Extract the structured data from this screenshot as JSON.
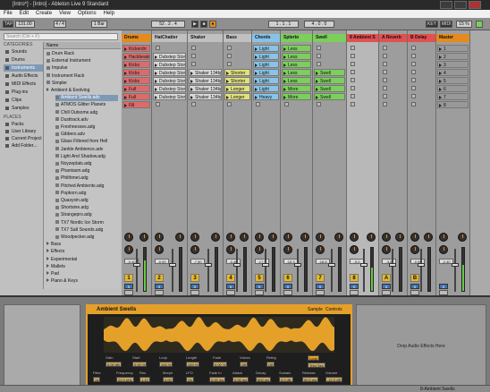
{
  "window": {
    "title": "[Intro*] - [Intro] - Ableton Live 9 Standard"
  },
  "menu": [
    "File",
    "Edit",
    "Create",
    "View",
    "Options",
    "Help"
  ],
  "transport": {
    "tap": "TAP",
    "tempo": "131.00",
    "signature": "4 / 4",
    "quantize": "1 Bar",
    "position": "52 . 2 . 4",
    "loop_start": "1 . 1 . 1",
    "loop_length": "4 . 0 . 0",
    "key": "KEY",
    "midi": "MIDI",
    "cpu": "15 %"
  },
  "browser": {
    "search_placeholder": "Search (Ctrl + F)",
    "categories_header": "CATEGORIES",
    "categories": [
      "Sounds",
      "Drums",
      "Instruments",
      "Audio Effects",
      "MIDI Effects",
      "Plug-ins",
      "Clips",
      "Samples"
    ],
    "places_header": "PLACES",
    "places": [
      "Packs",
      "User Library",
      "Current Project",
      "Add Folder..."
    ],
    "name_header": "Name",
    "files": [
      {
        "name": "Drum Rack",
        "indent": 0,
        "folder": false
      },
      {
        "name": "External Instrument",
        "indent": 0,
        "folder": false
      },
      {
        "name": "Impulse",
        "indent": 0,
        "folder": false
      },
      {
        "name": "Instrument Rack",
        "indent": 0,
        "folder": false
      },
      {
        "name": "Simpler",
        "indent": 0,
        "folder": false
      },
      {
        "name": "Ambient & Evolving",
        "indent": 0,
        "folder": true
      },
      {
        "name": "Ambient Swells.adv",
        "indent": 1,
        "folder": false,
        "selected": true
      },
      {
        "name": "ATMOS Glitter Planets",
        "indent": 1,
        "folder": false
      },
      {
        "name": "Chill Outsome.adg",
        "indent": 1,
        "folder": false
      },
      {
        "name": "Dusttrack.adv",
        "indent": 1,
        "folder": false
      },
      {
        "name": "Freshnesses.adg",
        "indent": 1,
        "folder": false
      },
      {
        "name": "Gibbers.adv",
        "indent": 1,
        "folder": false
      },
      {
        "name": "Glass Filtered from Hell",
        "indent": 1,
        "folder": false
      },
      {
        "name": "Jankle Ambience.adv",
        "indent": 1,
        "folder": false
      },
      {
        "name": "Light And Shadow.adg",
        "indent": 1,
        "folder": false
      },
      {
        "name": "Noyzeplats.adg",
        "indent": 1,
        "folder": false
      },
      {
        "name": "Phantasm.adg",
        "indent": 1,
        "folder": false
      },
      {
        "name": "Philthmet.adg",
        "indent": 1,
        "folder": false
      },
      {
        "name": "Pitched Ambients.adg",
        "indent": 1,
        "folder": false
      },
      {
        "name": "Popkorn.adg",
        "indent": 1,
        "folder": false
      },
      {
        "name": "Quasyxin.adg",
        "indent": 1,
        "folder": false
      },
      {
        "name": "Shortsine.adg",
        "indent": 1,
        "folder": false
      },
      {
        "name": "Strangepro.adg",
        "indent": 1,
        "folder": false
      },
      {
        "name": "TX7 Nordic Ice Storm",
        "indent": 1,
        "folder": false
      },
      {
        "name": "TX7 Salt Sounds.adg",
        "indent": 1,
        "folder": false
      },
      {
        "name": "Woodpecker.adg",
        "indent": 1,
        "folder": false
      },
      {
        "name": "Bass",
        "indent": 0,
        "folder": true
      },
      {
        "name": "Effects",
        "indent": 0,
        "folder": true
      },
      {
        "name": "Experimental",
        "indent": 0,
        "folder": true
      },
      {
        "name": "Mallets",
        "indent": 0,
        "folder": true
      },
      {
        "name": "Pad",
        "indent": 0,
        "folder": true
      },
      {
        "name": "Piano & Keys",
        "indent": 0,
        "folder": true
      }
    ]
  },
  "tracks": [
    {
      "name": "Drums",
      "color": "#e58a1c",
      "clipcolor": "#e06a6a",
      "clips": [
        "Kickerdrr",
        "Hackbeats",
        "Kicks",
        "Kicks",
        "Kicks",
        "Full",
        "Full",
        "Fill"
      ],
      "num": "1",
      "vol": "-0.40",
      "level": 0.7
    },
    {
      "name": "HatChatter",
      "color": "#c0c0c0",
      "clipcolor": "#d8d8d8",
      "clips": [
        "",
        "Dubstep Stone",
        "Dubstep Stone",
        "Dubstep Stone",
        "Dubstep Stone",
        "Dubstep Stone",
        "Dubstep Stone",
        ""
      ],
      "num": "2",
      "vol": "-0.00",
      "level": 0.0
    },
    {
      "name": "Shaker",
      "color": "#c0c0c0",
      "clipcolor": "#d8d8d8",
      "clips": [
        "",
        "",
        "",
        "Shaker 134bpm",
        "Shaker 134bpm",
        "Shaker 134bpm",
        "Shaker 134bpm",
        ""
      ],
      "num": "3",
      "vol": "-7.50",
      "level": 0.0
    },
    {
      "name": "Bass",
      "color": "#c0c0c0",
      "clipcolor": "#e2e27a",
      "clips": [
        "",
        "",
        "",
        "Shorter",
        "Shorter",
        "Longer",
        "Longer",
        ""
      ],
      "num": "4",
      "vol": "-0.40",
      "level": 0.0
    },
    {
      "name": "Chords",
      "color": "#88c3e8",
      "clipcolor": "#88c3e8",
      "clips": [
        "Light",
        "Light",
        "Light",
        "Light",
        "Light",
        "Light",
        "Heavy",
        ""
      ],
      "num": "5",
      "vol": "-17.9",
      "level": 0.0
    },
    {
      "name": "Splerto",
      "color": "#7bcf5a",
      "clipcolor": "#7bcf5a",
      "clips": [
        "Less",
        "Less",
        "Less",
        "Less",
        "Less",
        "More",
        "More",
        ""
      ],
      "num": "6",
      "vol": "-15.3",
      "level": 0.0
    },
    {
      "name": "Swell",
      "color": "#7bcf5a",
      "clipcolor": "#7bcf5a",
      "clips": [
        "",
        "",
        "",
        "Swell",
        "Swell",
        "Swell",
        "Swell",
        ""
      ],
      "num": "7",
      "vol": "-18.8",
      "level": 0.0
    },
    {
      "name": "8 Ambient S",
      "color": "#e25050",
      "clipcolor": "#e25050",
      "clips": [
        "",
        "",
        "",
        "",
        "",
        "",
        "",
        ""
      ],
      "num": "8",
      "vol": "-9.0",
      "level": 0.55
    },
    {
      "name": "A Reverb",
      "color": "#e25050",
      "clipcolor": "#e25050",
      "clips": [],
      "num": "A",
      "vol": "-3.8",
      "level": 0.0
    },
    {
      "name": "B Delay",
      "color": "#e25050",
      "clipcolor": "#e25050",
      "clips": [],
      "num": "B",
      "vol": "-0.98",
      "level": 0.0
    },
    {
      "name": "Master",
      "color": "#e58a1c",
      "clipcolor": "#999",
      "clips": [
        "1",
        "2",
        "3",
        "4",
        "5",
        "6",
        "7",
        "8"
      ],
      "num": "",
      "vol": "-2.40",
      "level": 0.6
    }
  ],
  "device": {
    "name": "Ambient Swells",
    "sample_label": "Sample",
    "controls_label": "Controls",
    "params": [
      {
        "label": "Gain",
        "value": "0.00 dB"
      },
      {
        "label": "Start",
        "value": "0.00 %"
      },
      {
        "label": "Loop",
        "value": "100 %"
      },
      {
        "label": "Length",
        "value": "100 %"
      },
      {
        "label": "Fade",
        "value": "0.00 %"
      },
      {
        "label": "Voices",
        "value": "Off"
      },
      {
        "label": "Retrig",
        "value": "Off"
      }
    ],
    "bottom_params": [
      {
        "label": "Filter",
        "value": "14"
      },
      {
        "label": "Frequency",
        "value": "22.0 kHz"
      },
      {
        "label": "Res",
        "value": "1.10"
      },
      {
        "label": "Morph",
        "value": "0.00"
      },
      {
        "label": "LFO",
        "value": "On"
      },
      {
        "label": "Fade In",
        "value": "0.00 ms"
      },
      {
        "label": "Attack",
        "value": "0.00 ms"
      },
      {
        "label": "Decay",
        "value": "600 ms"
      },
      {
        "label": "Sustain",
        "value": "0.0 dB"
      },
      {
        "label": "Release",
        "value": "50.0 ms"
      },
      {
        "label": "Volume",
        "value": "-12.0 dB"
      }
    ],
    "loop_label": "Loop",
    "trim_label": "Trim Sec"
  },
  "dropzone": "Drop Audio Effects Here",
  "status": "8-Ambient Swells"
}
